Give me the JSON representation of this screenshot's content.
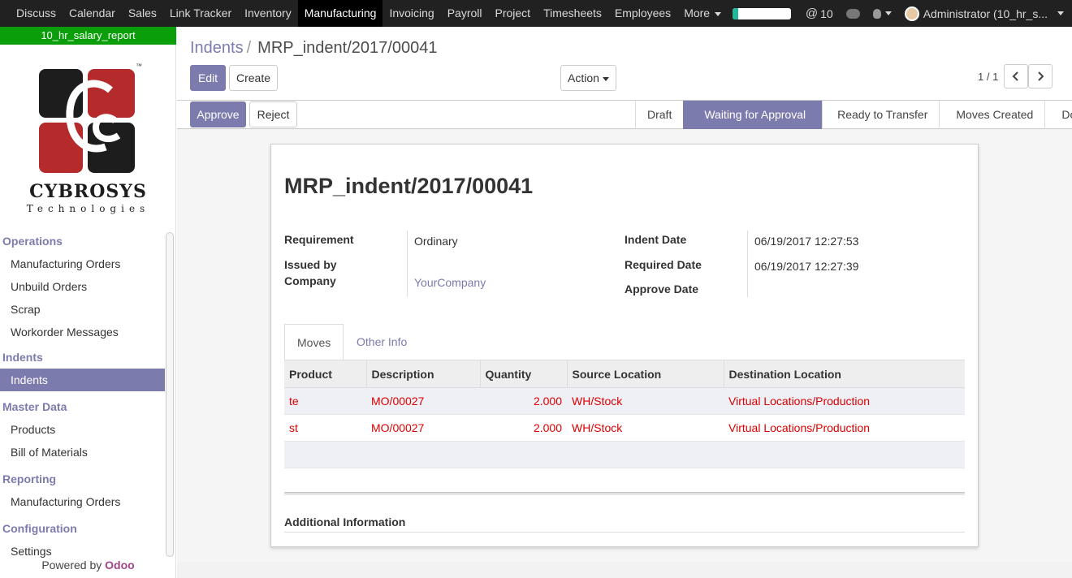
{
  "topbar": {
    "apps": [
      "Discuss",
      "Calendar",
      "Sales",
      "Link Tracker",
      "Inventory",
      "Manufacturing",
      "Invoicing",
      "Payroll",
      "Project",
      "Timesheets",
      "Employees"
    ],
    "more_label": "More",
    "progress": 0.1,
    "mentions_count": "10",
    "user": "Administrator (10_hr_s..."
  },
  "sidebar": {
    "db_name": "10_hr_salary_report",
    "logo_name": "CYBROSYS",
    "logo_sub": "Technologies",
    "logo_tm": "™",
    "sections": [
      {
        "title": "Operations",
        "items": [
          "Manufacturing Orders",
          "Unbuild Orders",
          "Scrap",
          "Workorder Messages"
        ]
      },
      {
        "title": "Indents",
        "items": [
          "Indents"
        ]
      },
      {
        "title": "Master Data",
        "items": [
          "Products",
          "Bill of Materials"
        ]
      },
      {
        "title": "Reporting",
        "items": [
          "Manufacturing Orders"
        ]
      },
      {
        "title": "Configuration",
        "items": [
          "Settings"
        ]
      }
    ],
    "active_item": "Indents",
    "powered_prefix": "Powered by",
    "powered_brand": "Odoo"
  },
  "control_panel": {
    "breadcrumb_parent": "Indents",
    "breadcrumb_sep": "/",
    "breadcrumb_current": "MRP_indent/2017/00041",
    "edit_label": "Edit",
    "create_label": "Create",
    "action_label": "Action",
    "pager": "1 / 1"
  },
  "statusbar": {
    "approve_label": "Approve",
    "reject_label": "Reject",
    "stages": [
      "Draft",
      "Waiting for Approval",
      "Ready to Transfer",
      "Moves Created",
      "Done"
    ],
    "active_stage": "Waiting for Approval"
  },
  "record": {
    "title": "MRP_indent/2017/00041",
    "requirement_label": "Requirement",
    "requirement": "Ordinary",
    "issued_label_1": "Issued by",
    "issued_label_2": "Company",
    "issued_by": "YourCompany",
    "indent_date_label": "Indent Date",
    "indent_date": "06/19/2017 12:27:53",
    "required_date_label": "Required Date",
    "required_date": "06/19/2017 12:27:39",
    "approve_date_label": "Approve Date"
  },
  "tabs": [
    "Moves",
    "Other Info"
  ],
  "moves": {
    "columns": [
      "Product",
      "Description",
      "Quantity",
      "Source Location",
      "Destination Location"
    ],
    "rows": [
      [
        "te",
        "MO/00027",
        "2.000",
        "WH/Stock",
        "Virtual Locations/Production"
      ],
      [
        "st",
        "MO/00027",
        "2.000",
        "WH/Stock",
        "Virtual Locations/Production"
      ]
    ]
  },
  "additional_info_label": "Additional Information",
  "colors": {
    "primary": "#7c7bad",
    "danger": "#dd0000",
    "db_banner": "#0b9e0b",
    "navbar": "#212121"
  }
}
